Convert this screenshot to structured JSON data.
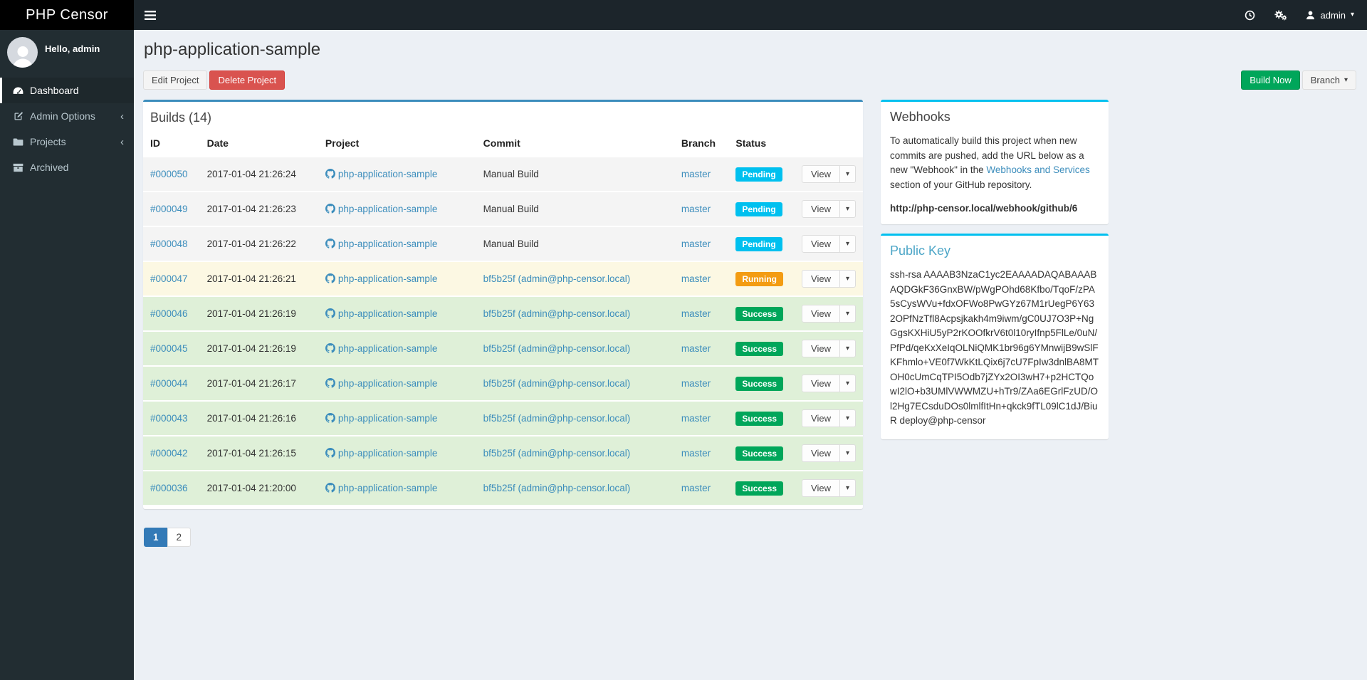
{
  "brand": {
    "title": "PHP Censor"
  },
  "topbar": {
    "user_label": "admin"
  },
  "sidebar": {
    "greeting": "Hello, admin",
    "items": [
      {
        "label": "Dashboard",
        "icon": "dashboard-icon",
        "active": true
      },
      {
        "label": "Admin Options",
        "icon": "edit-icon",
        "has_submenu": true
      },
      {
        "label": "Projects",
        "icon": "folder-icon",
        "has_submenu": true
      },
      {
        "label": "Archived",
        "icon": "archive-icon"
      }
    ]
  },
  "page": {
    "title": "php-application-sample",
    "edit_label": "Edit Project",
    "delete_label": "Delete Project",
    "build_now_label": "Build Now",
    "branch_label": "Branch"
  },
  "builds": {
    "title": "Builds (14)",
    "columns": [
      "ID",
      "Date",
      "Project",
      "Commit",
      "Branch",
      "Status"
    ],
    "view_label": "View",
    "rows": [
      {
        "id": "#000050",
        "date": "2017-01-04 21:26:24",
        "project": "php-application-sample",
        "commit": "Manual Build",
        "commit_is_link": false,
        "branch": "master",
        "status": "Pending"
      },
      {
        "id": "#000049",
        "date": "2017-01-04 21:26:23",
        "project": "php-application-sample",
        "commit": "Manual Build",
        "commit_is_link": false,
        "branch": "master",
        "status": "Pending"
      },
      {
        "id": "#000048",
        "date": "2017-01-04 21:26:22",
        "project": "php-application-sample",
        "commit": "Manual Build",
        "commit_is_link": false,
        "branch": "master",
        "status": "Pending"
      },
      {
        "id": "#000047",
        "date": "2017-01-04 21:26:21",
        "project": "php-application-sample",
        "commit": "bf5b25f (admin@php-censor.local)",
        "commit_is_link": true,
        "branch": "master",
        "status": "Running"
      },
      {
        "id": "#000046",
        "date": "2017-01-04 21:26:19",
        "project": "php-application-sample",
        "commit": "bf5b25f (admin@php-censor.local)",
        "commit_is_link": true,
        "branch": "master",
        "status": "Success"
      },
      {
        "id": "#000045",
        "date": "2017-01-04 21:26:19",
        "project": "php-application-sample",
        "commit": "bf5b25f (admin@php-censor.local)",
        "commit_is_link": true,
        "branch": "master",
        "status": "Success"
      },
      {
        "id": "#000044",
        "date": "2017-01-04 21:26:17",
        "project": "php-application-sample",
        "commit": "bf5b25f (admin@php-censor.local)",
        "commit_is_link": true,
        "branch": "master",
        "status": "Success"
      },
      {
        "id": "#000043",
        "date": "2017-01-04 21:26:16",
        "project": "php-application-sample",
        "commit": "bf5b25f (admin@php-censor.local)",
        "commit_is_link": true,
        "branch": "master",
        "status": "Success"
      },
      {
        "id": "#000042",
        "date": "2017-01-04 21:26:15",
        "project": "php-application-sample",
        "commit": "bf5b25f (admin@php-censor.local)",
        "commit_is_link": true,
        "branch": "master",
        "status": "Success"
      },
      {
        "id": "#000036",
        "date": "2017-01-04 21:20:00",
        "project": "php-application-sample",
        "commit": "bf5b25f (admin@php-censor.local)",
        "commit_is_link": true,
        "branch": "master",
        "status": "Success"
      }
    ],
    "pagination": [
      {
        "label": "1",
        "active": true
      },
      {
        "label": "2",
        "active": false
      }
    ]
  },
  "webhooks": {
    "title": "Webhooks",
    "text_before": "To automatically build this project when new commits are pushed, add the URL below as a new \"Webhook\" in the ",
    "link_text": "Webhooks and Services",
    "text_after": " section of your GitHub repository.",
    "url": "http://php-censor.local/webhook/github/6"
  },
  "public_key": {
    "title": "Public Key",
    "key": "ssh-rsa AAAAB3NzaC1yc2EAAAADAQABAAABAQDGkF36GnxBW/pWgPOhd68Kfbo/TqoF/zPA5sCysWVu+fdxOFWo8PwGYz67M1rUegP6Y632OPfNzTfl8Acpsjkakh4m9iwm/gC0UJ7O3P+NgGgsKXHiU5yP2rKOOfkrV6t0l10ryIfnp5FlLe/0uN/PfPd/qeKxXeIqOLNiQMK1br96g6YMnwijB9wSlFKFhmlo+VE0f7WkKtLQix6j7cU7FpIw3dnlBA8MTOH0cUmCqTPI5Odb7jZYx2OI3wH7+p2HCTQowI2lO+b3UMlVWWMZU+hTr9/ZAa6EGrlFzUD/Ol2Hg7ECsduDOs0lmlfItHn+qkck9fTL09lC1dJ/BiuR deploy@php-censor"
  },
  "colors": {
    "accent_blue": "#3c8dbc",
    "info_cyan": "#00c0ef",
    "build_now_green": "#00a65a",
    "delete_red": "#d9534f",
    "pagination_active": "#337ab7",
    "public_key_title": "#4da6c7",
    "status_badge": {
      "Pending": "#00c0ef",
      "Running": "#f39c12",
      "Success": "#00a65a"
    },
    "row_bg": {
      "Pending": "#f4f4f4",
      "Running": "#fcf8e3",
      "Success": "#dff0d8"
    }
  }
}
